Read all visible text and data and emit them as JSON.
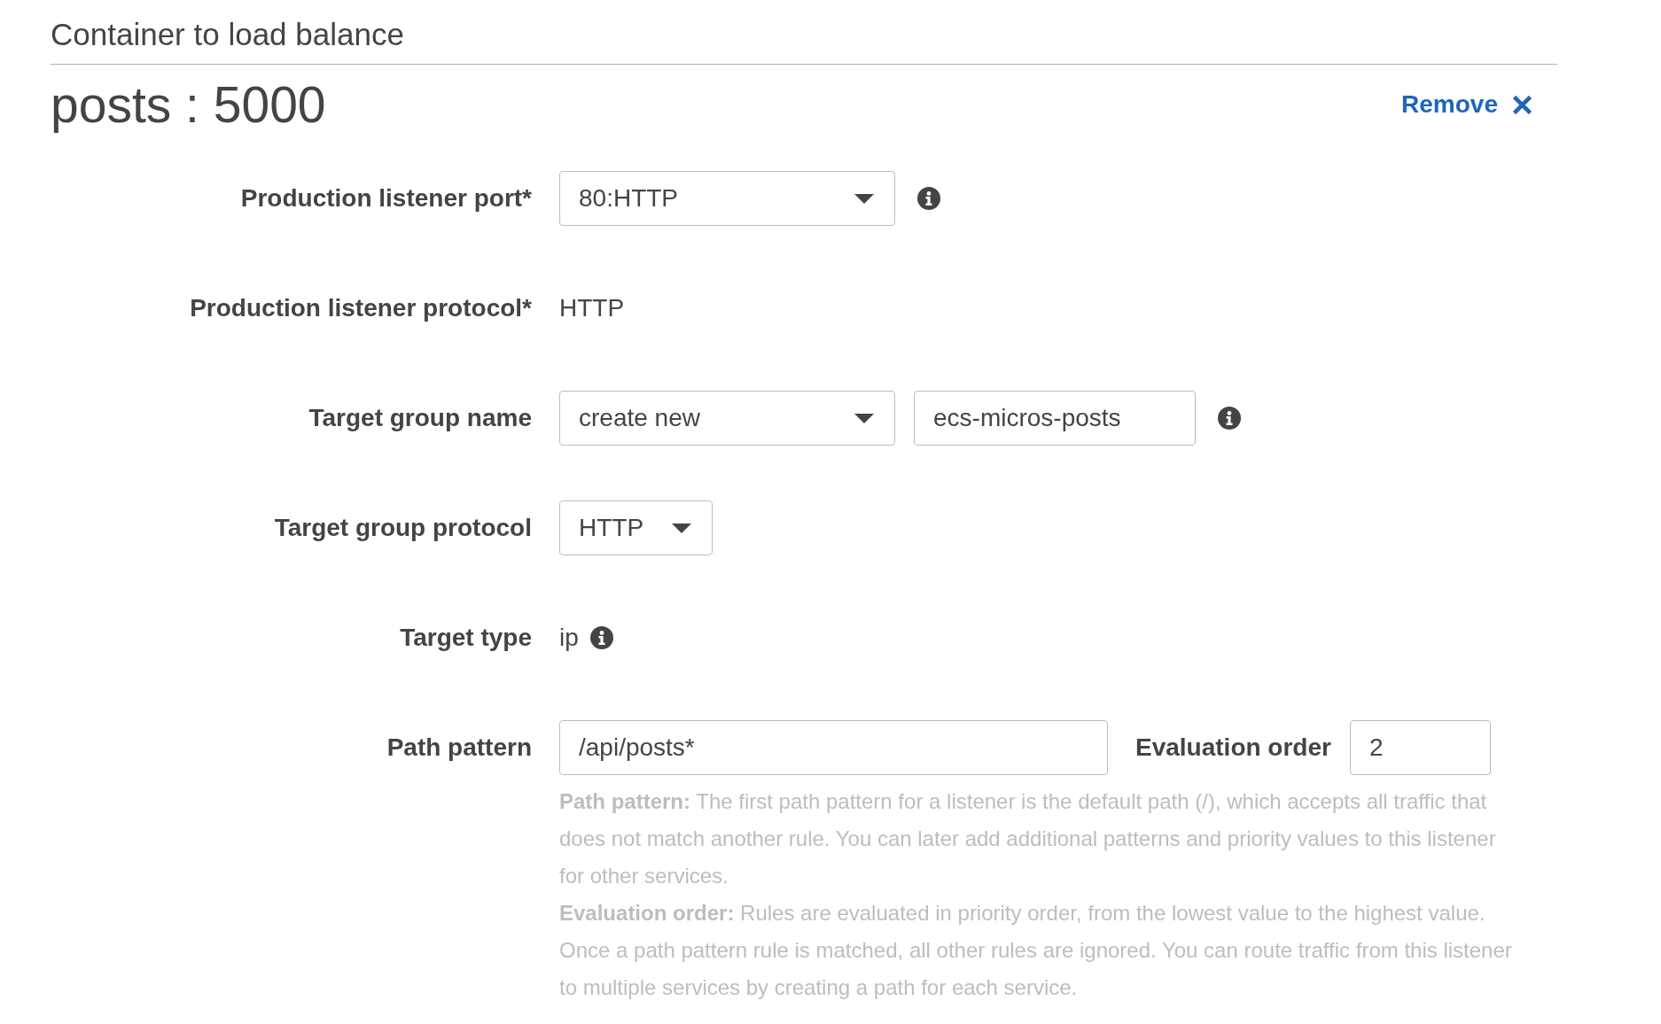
{
  "section": {
    "title": "Container to load balance"
  },
  "container": {
    "name": "posts : 5000",
    "remove": {
      "label": "Remove"
    }
  },
  "fields": [
    {
      "label": "Production listener port*",
      "controls": [
        {
          "kind": "select",
          "value": "80:HTTP"
        }
      ],
      "info": true
    },
    {
      "label": "Production listener protocol*",
      "controls": [
        {
          "kind": "static",
          "value": "HTTP"
        }
      ],
      "info": false
    },
    {
      "label": "Target group name",
      "controls": [
        {
          "kind": "select",
          "value": "create new"
        },
        {
          "kind": "text",
          "value": "ecs-micros-posts"
        }
      ],
      "info": true
    },
    {
      "label": "Target group protocol",
      "controls": [
        {
          "kind": "select",
          "value": "HTTP"
        }
      ],
      "info": false
    },
    {
      "label": "Target type",
      "controls": [
        {
          "kind": "static",
          "value": "ip"
        }
      ],
      "info": true
    },
    {
      "label": "Path pattern",
      "controls": [
        {
          "kind": "text",
          "value": "/api/posts*"
        },
        {
          "kind": "label",
          "value": "Evaluation order"
        },
        {
          "kind": "text",
          "value": "2"
        }
      ],
      "info": false
    }
  ],
  "help": [
    "**Path pattern:** The first path pattern for a listener is the default path (/), which accepts all traffic that does not match another rule. You can later add additional patterns and priority values to this listener for other services.",
    "**Evaluation order:** Rules are evaluated in priority order, from the lowest value to the highest value. Once a path pattern rule is matched, all other rules are ignored. You can route traffic from this listener to multiple services by creating a path for each service."
  ]
}
